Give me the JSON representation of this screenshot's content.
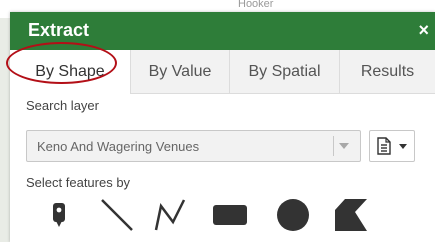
{
  "map": {
    "background_text": "Hooker"
  },
  "panel": {
    "title": "Extract",
    "close_symbol": "×",
    "header_color": "#2e7d39"
  },
  "tabs": [
    {
      "label": "By Shape",
      "active": true
    },
    {
      "label": "By Value",
      "active": false
    },
    {
      "label": "By Spatial",
      "active": false
    },
    {
      "label": "Results",
      "active": false
    }
  ],
  "annotation": {
    "color": "#b30f17"
  },
  "search_layer": {
    "label": "Search layer",
    "selected_value": "Keno And Wagering Venues",
    "options_icon": "document-list-icon"
  },
  "select_features": {
    "label": "Select features by",
    "tools": [
      {
        "icon": "point-marker-icon"
      },
      {
        "icon": "line-icon"
      },
      {
        "icon": "polyline-icon"
      },
      {
        "icon": "rectangle-icon"
      },
      {
        "icon": "circle-icon"
      },
      {
        "icon": "polygon-icon"
      }
    ]
  }
}
